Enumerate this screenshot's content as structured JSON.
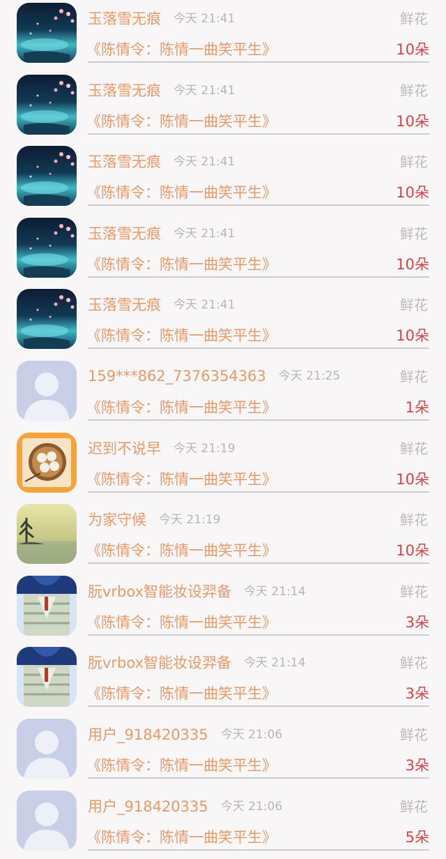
{
  "items": [
    {
      "avatar": "night-sakura-landscape",
      "name": "玉落雪无痕",
      "time": "今天 21:41",
      "type": "鲜花",
      "title": "《陈情令：陈情一曲笑平生》",
      "count": "10朵"
    },
    {
      "avatar": "night-sakura-landscape",
      "name": "玉落雪无痕",
      "time": "今天 21:41",
      "type": "鲜花",
      "title": "《陈情令：陈情一曲笑平生》",
      "count": "10朵"
    },
    {
      "avatar": "night-sakura-landscape",
      "name": "玉落雪无痕",
      "time": "今天 21:41",
      "type": "鲜花",
      "title": "《陈情令：陈情一曲笑平生》",
      "count": "10朵"
    },
    {
      "avatar": "night-sakura-landscape",
      "name": "玉落雪无痕",
      "time": "今天 21:41",
      "type": "鲜花",
      "title": "《陈情令：陈情一曲笑平生》",
      "count": "10朵"
    },
    {
      "avatar": "night-sakura-landscape",
      "name": "玉落雪无痕",
      "time": "今天 21:41",
      "type": "鲜花",
      "title": "《陈情令：陈情一曲笑平生》",
      "count": "10朵"
    },
    {
      "avatar": "default-user",
      "name": "159***862_7376354363",
      "time": "今天 21:25",
      "type": "鲜花",
      "title": "《陈情令：陈情一曲笑平生》",
      "count": "1朵"
    },
    {
      "avatar": "food-basket",
      "name": "迟到不说早",
      "time": "今天 21:19",
      "type": "鲜花",
      "title": "《陈情令：陈情一曲笑平生》",
      "count": "10朵"
    },
    {
      "avatar": "misty-lake",
      "name": "为家守候",
      "time": "今天 21:19",
      "type": "鲜花",
      "title": "《陈情令：陈情一曲笑平生》",
      "count": "10朵"
    },
    {
      "avatar": "sweater-figure",
      "name": "朊vrbox智能妆设羿备",
      "time": "今天 21:14",
      "type": "鲜花",
      "title": "《陈情令：陈情一曲笑平生》",
      "count": "3朵"
    },
    {
      "avatar": "sweater-figure",
      "name": "朊vrbox智能妆设羿备",
      "time": "今天 21:14",
      "type": "鲜花",
      "title": "《陈情令：陈情一曲笑平生》",
      "count": "3朵"
    },
    {
      "avatar": "default-user",
      "name": "用户_918420335",
      "time": "今天 21:06",
      "type": "鲜花",
      "title": "《陈情令：陈情一曲笑平生》",
      "count": "3朵"
    },
    {
      "avatar": "default-user",
      "name": "用户_918420335",
      "time": "今天 21:06",
      "type": "鲜花",
      "title": "《陈情令：陈情一曲笑平生》",
      "count": "5朵"
    }
  ]
}
